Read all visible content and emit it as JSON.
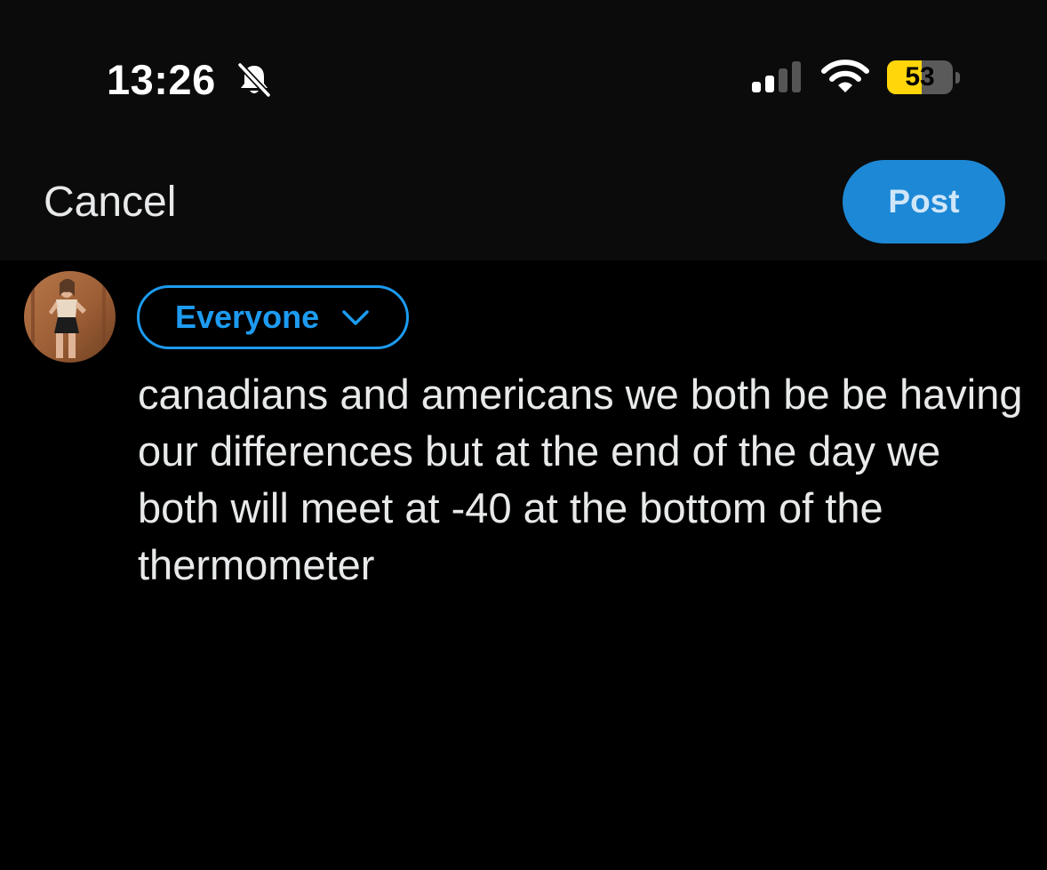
{
  "status_bar": {
    "time": "13:26",
    "battery_level": "53",
    "battery_fraction": 0.53,
    "battery_color": "#ffd60a",
    "icons": [
      "bell-slash-icon",
      "cellular-signal-icon",
      "wifi-icon",
      "battery-icon"
    ]
  },
  "nav": {
    "cancel_label": "Cancel",
    "post_label": "Post"
  },
  "compose": {
    "audience_label": "Everyone",
    "audience_icon": "chevron-down-icon",
    "text": "canadians and americans we both be be having our differences but at the end of the day we both will meet at -40 at the bottom of the thermometer"
  },
  "colors": {
    "accent": "#1d9bf0",
    "post_button_bg": "#1d88d6",
    "background": "#000000",
    "header_background": "#0b0b0b"
  }
}
